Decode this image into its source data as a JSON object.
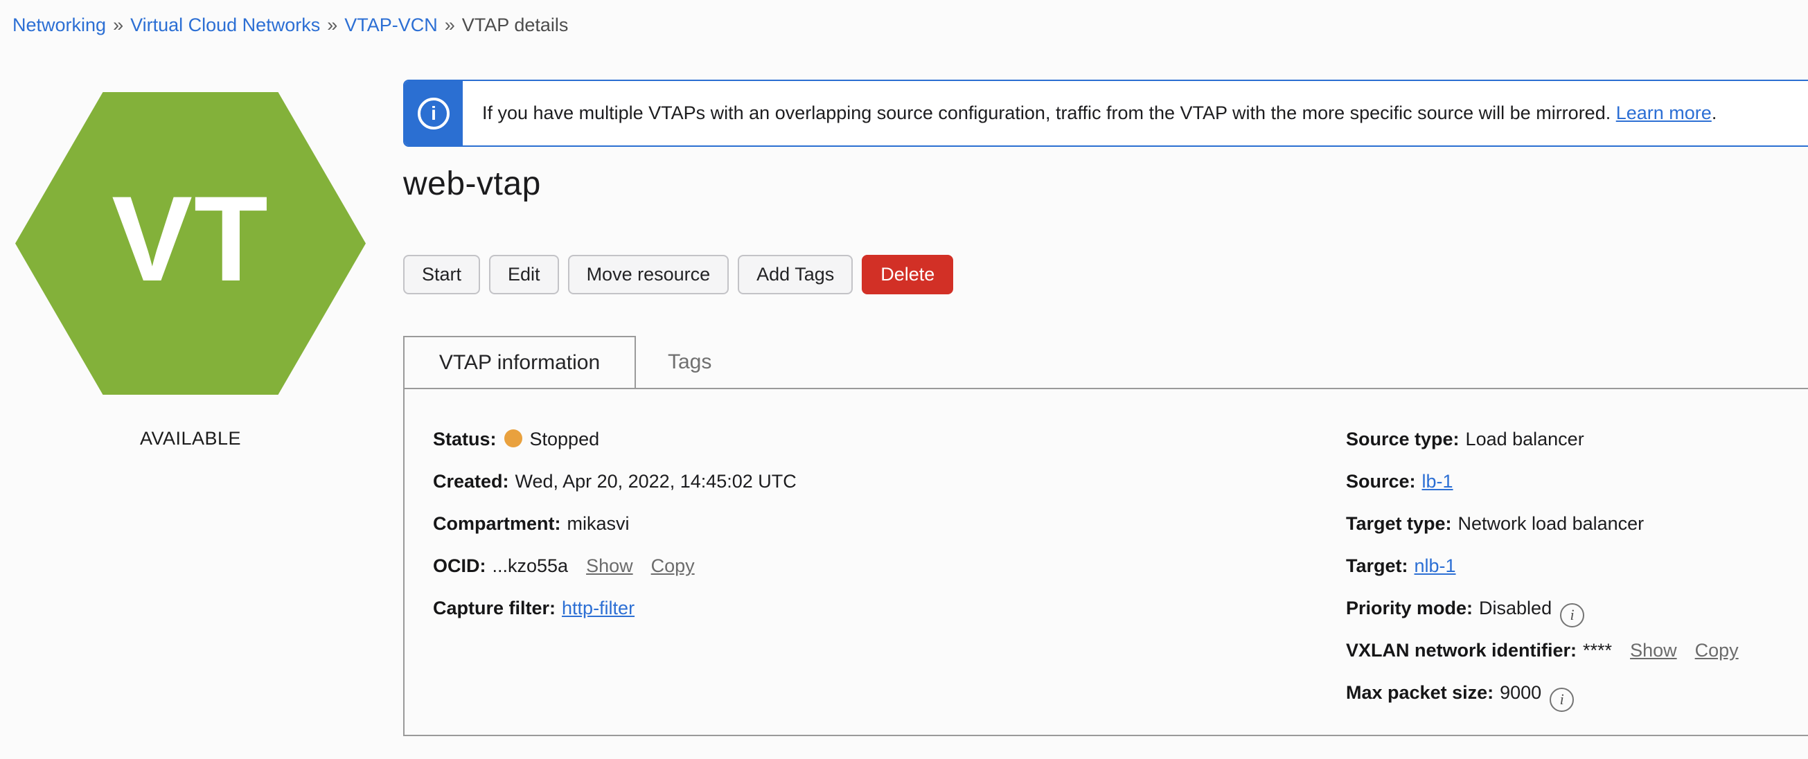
{
  "breadcrumb": {
    "separator": "»",
    "items": [
      {
        "label": "Networking",
        "type": "link"
      },
      {
        "label": "Virtual Cloud Networks",
        "type": "link"
      },
      {
        "label": "VTAP-VCN",
        "type": "link"
      },
      {
        "label": "VTAP details",
        "type": "current"
      }
    ]
  },
  "banner": {
    "info_icon": "i",
    "message": "If you have multiple VTAPs with an overlapping source configuration, traffic from the VTAP with the more specific source will be mirrored.",
    "link_label": "Learn more",
    "suffix": ".",
    "accent_color": "#2b6fd2"
  },
  "resource": {
    "title": "web-vtap",
    "hexagon_initials": "VT",
    "hexagon_color": "#83b13a",
    "availability": "AVAILABLE"
  },
  "actions": [
    {
      "label": "Start",
      "style": "default"
    },
    {
      "label": "Edit",
      "style": "default"
    },
    {
      "label": "Move resource",
      "style": "default"
    },
    {
      "label": "Add Tags",
      "style": "default"
    },
    {
      "label": "Delete",
      "style": "danger"
    }
  ],
  "tabs": [
    {
      "label": "VTAP information",
      "active": true
    },
    {
      "label": "Tags",
      "active": false
    }
  ],
  "details": {
    "left": [
      {
        "label": "Status:",
        "value": "Stopped",
        "dot_color": "#e9a13e"
      },
      {
        "label": "Created:",
        "value": "Wed, Apr 20, 2022, 14:45:02 UTC"
      },
      {
        "label": "Compartment:",
        "value": "mikasvi"
      },
      {
        "label": "OCID:",
        "value": "...kzo55a",
        "links": [
          "Show",
          "Copy"
        ]
      },
      {
        "label": "Capture filter:",
        "value": "http-filter",
        "value_is_link": true
      }
    ],
    "right": [
      {
        "label": "Source type:",
        "value": "Load balancer"
      },
      {
        "label": "Source:",
        "value": "lb-1",
        "value_is_link": true
      },
      {
        "label": "Target type:",
        "value": "Network load balancer"
      },
      {
        "label": "Target:",
        "value": "nlb-1",
        "value_is_link": true
      },
      {
        "label": "Priority mode:",
        "value": "Disabled",
        "info": true
      },
      {
        "label": "VXLAN network identifier:",
        "value": "****",
        "links": [
          "Show",
          "Copy"
        ]
      },
      {
        "label": "Max packet size:",
        "value": "9000",
        "info": true
      }
    ]
  },
  "status_colors": {
    "stopped_dot": "#e9a13e"
  }
}
